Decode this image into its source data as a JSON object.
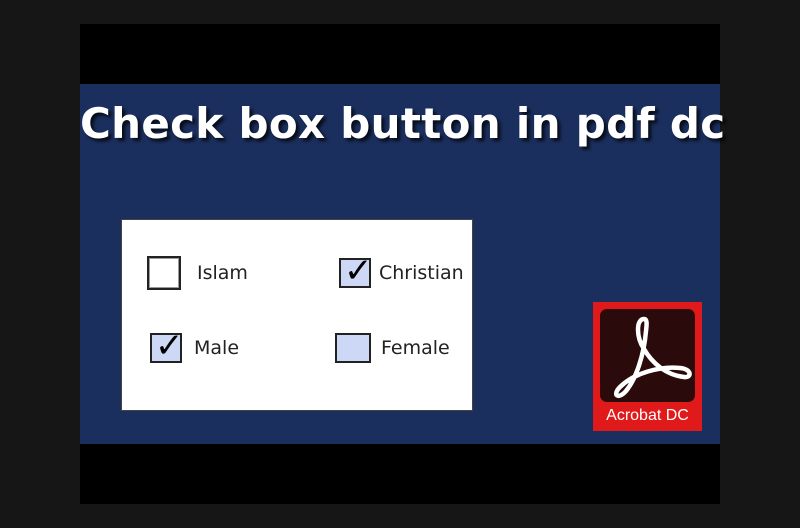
{
  "title": "Check box button in pdf dc",
  "checkboxes": [
    {
      "label": "Islam",
      "checked": false
    },
    {
      "label": "Christian",
      "checked": true
    },
    {
      "label": "Male",
      "checked": true
    },
    {
      "label": "Female",
      "checked": false
    }
  ],
  "checkmark_glyph": "✓",
  "logo": {
    "label": "Acrobat DC",
    "icon": "acrobat-logo-icon",
    "colors": {
      "badge": "#e01a1a",
      "inner": "#2a0a0a"
    }
  },
  "colors": {
    "panel": "#1b2f5e",
    "frame": "#000000",
    "checkbox_fill": "#cdd8f6"
  }
}
